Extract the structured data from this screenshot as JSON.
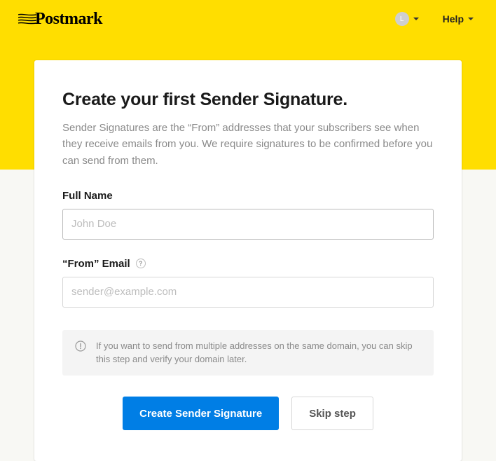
{
  "header": {
    "brand": "Postmark",
    "avatar_initial": "L",
    "help_label": "Help"
  },
  "page": {
    "title": "Create your first Sender Signature.",
    "description": "Sender Signatures are the “From” addresses that your subscribers see when they receive emails from you. We require signatures to be confirmed before you can send from them."
  },
  "form": {
    "full_name": {
      "label": "Full Name",
      "placeholder": "John Doe",
      "value": ""
    },
    "from_email": {
      "label": "“From” Email",
      "placeholder": "sender@example.com",
      "value": ""
    }
  },
  "info": {
    "text": "If you want to send from multiple addresses on the same domain, you can skip this step and verify your domain later."
  },
  "actions": {
    "primary": "Create Sender Signature",
    "secondary": "Skip step"
  },
  "colors": {
    "brand_yellow": "#ffde00",
    "primary_blue": "#007ee5"
  }
}
